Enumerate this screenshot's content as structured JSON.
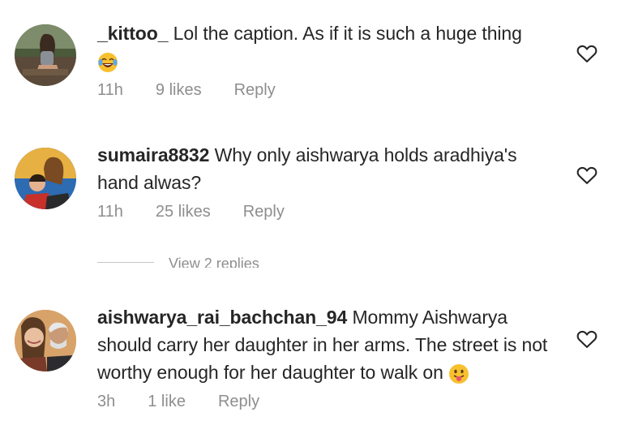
{
  "comments": [
    {
      "username": "_kittoo_",
      "text": " Lol the caption. As if it is such a huge thing",
      "emoji": "face-with-tears-of-joy-emoji",
      "time": "11h",
      "likes": "9 likes",
      "reply": "Reply",
      "icons": {
        "like": "heart-outline-icon"
      }
    },
    {
      "username": "sumaira8832",
      "text": " Why only aishwarya holds aradhiya's hand alwas?",
      "time": "11h",
      "likes": "25 likes",
      "reply": "Reply",
      "view_replies": "View 2 replies",
      "icons": {
        "like": "heart-outline-icon"
      }
    },
    {
      "username": "aishwarya_rai_bachchan_94",
      "text": " Mommy Aishwarya should carry her daughter in her arms. The street is not worthy enough for her daughter to walk on ",
      "emoji": "face-with-tongue-emoji",
      "time": "3h",
      "likes": "1 like",
      "reply": "Reply",
      "icons": {
        "like": "heart-outline-icon"
      }
    }
  ],
  "colors": {
    "primary_text": "#262626",
    "secondary_text": "#8e8e8e",
    "divider": "#c7c7c7",
    "background": "#ffffff"
  }
}
